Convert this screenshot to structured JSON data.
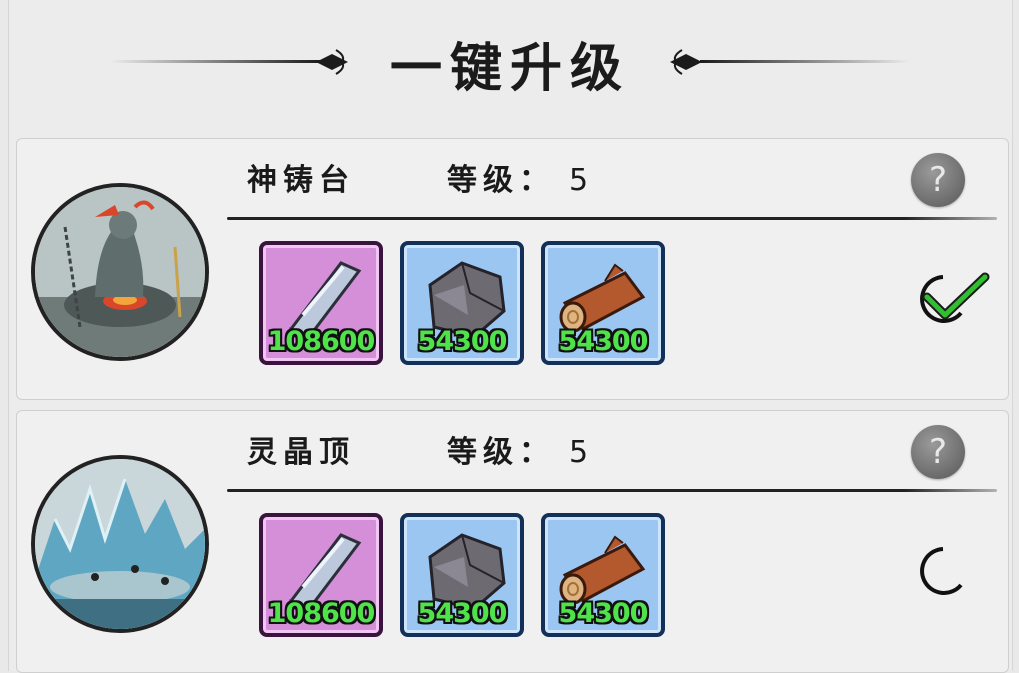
{
  "title": "一键升级",
  "level_label": "等级：",
  "buildings": [
    {
      "name": "神铸台",
      "level": "5",
      "checked": true,
      "resources": [
        {
          "icon": "crystal-icon",
          "amount": "108600",
          "rarity": "purple"
        },
        {
          "icon": "ore-icon",
          "amount": "54300",
          "rarity": "blue"
        },
        {
          "icon": "log-icon",
          "amount": "54300",
          "rarity": "blue"
        }
      ]
    },
    {
      "name": "灵晶顶",
      "level": "5",
      "checked": false,
      "resources": [
        {
          "icon": "crystal-icon",
          "amount": "108600",
          "rarity": "purple"
        },
        {
          "icon": "ore-icon",
          "amount": "54300",
          "rarity": "blue"
        },
        {
          "icon": "log-icon",
          "amount": "54300",
          "rarity": "blue"
        }
      ]
    }
  ],
  "help_symbol": "?",
  "colors": {
    "amount_text": "#4fe24a",
    "check_green": "#2fbf2f",
    "purple_slot": "#d58ed8",
    "blue_slot": "#9cc6f2"
  }
}
